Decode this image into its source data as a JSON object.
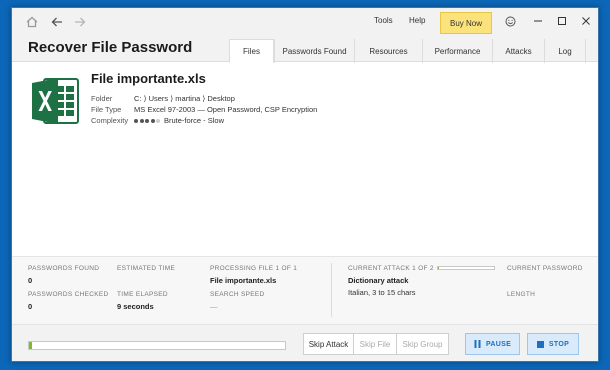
{
  "titlebar": {
    "menu": {
      "tools": "Tools",
      "help": "Help"
    },
    "buy_now": "Buy Now"
  },
  "header": {
    "title": "Recover File Password",
    "tabs": [
      {
        "label": "Files",
        "active": true
      },
      {
        "label": "Passwords Found",
        "active": false
      },
      {
        "label": "Resources",
        "active": false
      },
      {
        "label": "Performance",
        "active": false
      },
      {
        "label": "Attacks",
        "active": false
      },
      {
        "label": "Log",
        "active": false
      }
    ]
  },
  "file": {
    "icon": "excel-file-icon",
    "accent_color": "#1e7145",
    "name": "File importante.xls",
    "folder_label": "Folder",
    "folder_value": "C: ⟩ Users ⟩ martina ⟩ Desktop",
    "type_label": "File Type",
    "type_value": "MS Excel 97-2003 — Open Password, CSP Encryption",
    "complexity_label": "Complexity",
    "complexity_value": "Brute-force - Slow",
    "complexity_dots_filled": 4,
    "complexity_dots_total": 5
  },
  "stats": {
    "passwords_found_label": "PASSWORDS FOUND",
    "passwords_found_value": "0",
    "passwords_checked_label": "PASSWORDS CHECKED",
    "passwords_checked_value": "0",
    "estimated_time_label": "ESTIMATED TIME",
    "estimated_time_value": "",
    "time_elapsed_label": "TIME ELAPSED",
    "time_elapsed_value": "9 seconds",
    "processing_label": "PROCESSING FILE 1 OF 1",
    "processing_value": "File importante.xls",
    "search_speed_label": "SEARCH SPEED",
    "search_speed_value": "—",
    "current_attack_label": "CURRENT ATTACK 1 OF 2",
    "current_attack_progress": 0.02,
    "current_attack_value": "Dictionary attack",
    "current_attack_detail": "Italian, 3 to 15 chars",
    "current_password_label": "CURRENT PASSWORD",
    "length_label": "LENGTH"
  },
  "footer": {
    "overall_progress": 0.01,
    "progress_color": "#7dbb2d",
    "skip_attack": "Skip Attack",
    "skip_file": "Skip File",
    "skip_group": "Skip Group",
    "pause": "PAUSE",
    "stop": "STOP"
  }
}
